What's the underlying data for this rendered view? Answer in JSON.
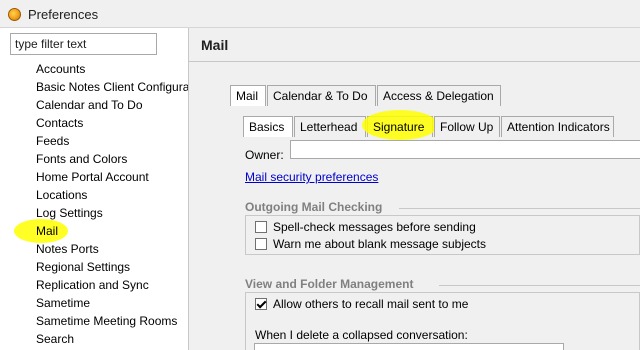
{
  "window": {
    "title": "Preferences"
  },
  "filter": {
    "placeholder": "type filter text"
  },
  "nav": {
    "items": [
      {
        "label": "Accounts"
      },
      {
        "label": "Basic Notes Client Configura"
      },
      {
        "label": "Calendar and To Do"
      },
      {
        "label": "Contacts"
      },
      {
        "label": "Feeds"
      },
      {
        "label": "Fonts and Colors"
      },
      {
        "label": "Home Portal Account"
      },
      {
        "label": "Locations"
      },
      {
        "label": "Log Settings"
      },
      {
        "label": "Mail",
        "selected": true,
        "highlighted": true
      },
      {
        "label": "Notes Ports"
      },
      {
        "label": "Regional Settings"
      },
      {
        "label": "Replication and Sync"
      },
      {
        "label": "Sametime"
      },
      {
        "label": "Sametime Meeting Rooms"
      },
      {
        "label": "Search"
      }
    ]
  },
  "page": {
    "title": "Mail"
  },
  "tabs_top": [
    {
      "label": "Mail",
      "active": true
    },
    {
      "label": "Calendar & To Do"
    },
    {
      "label": "Access & Delegation"
    }
  ],
  "tabs_sub": [
    {
      "label": "Basics",
      "active": true
    },
    {
      "label": "Letterhead"
    },
    {
      "label": "Signature",
      "highlighted": true
    },
    {
      "label": "Follow Up"
    },
    {
      "label": "Attention Indicators"
    }
  ],
  "owner": {
    "label": "Owner:",
    "value": ""
  },
  "links": {
    "mail_security": "Mail security preferences"
  },
  "outgoing": {
    "title": "Outgoing Mail Checking",
    "options": [
      {
        "label": "Spell-check messages before sending",
        "checked": false
      },
      {
        "label": "Warn me about blank message subjects",
        "checked": false
      }
    ]
  },
  "view_folder": {
    "title": "View and Folder Management",
    "options": [
      {
        "label": "Allow others to recall mail sent to me",
        "checked": true
      }
    ],
    "delete_label": "When I delete a collapsed conversation:"
  },
  "colors": {
    "highlight": "#ffff00",
    "link": "#0000cc",
    "panel_bg": "#f0f0f0"
  }
}
